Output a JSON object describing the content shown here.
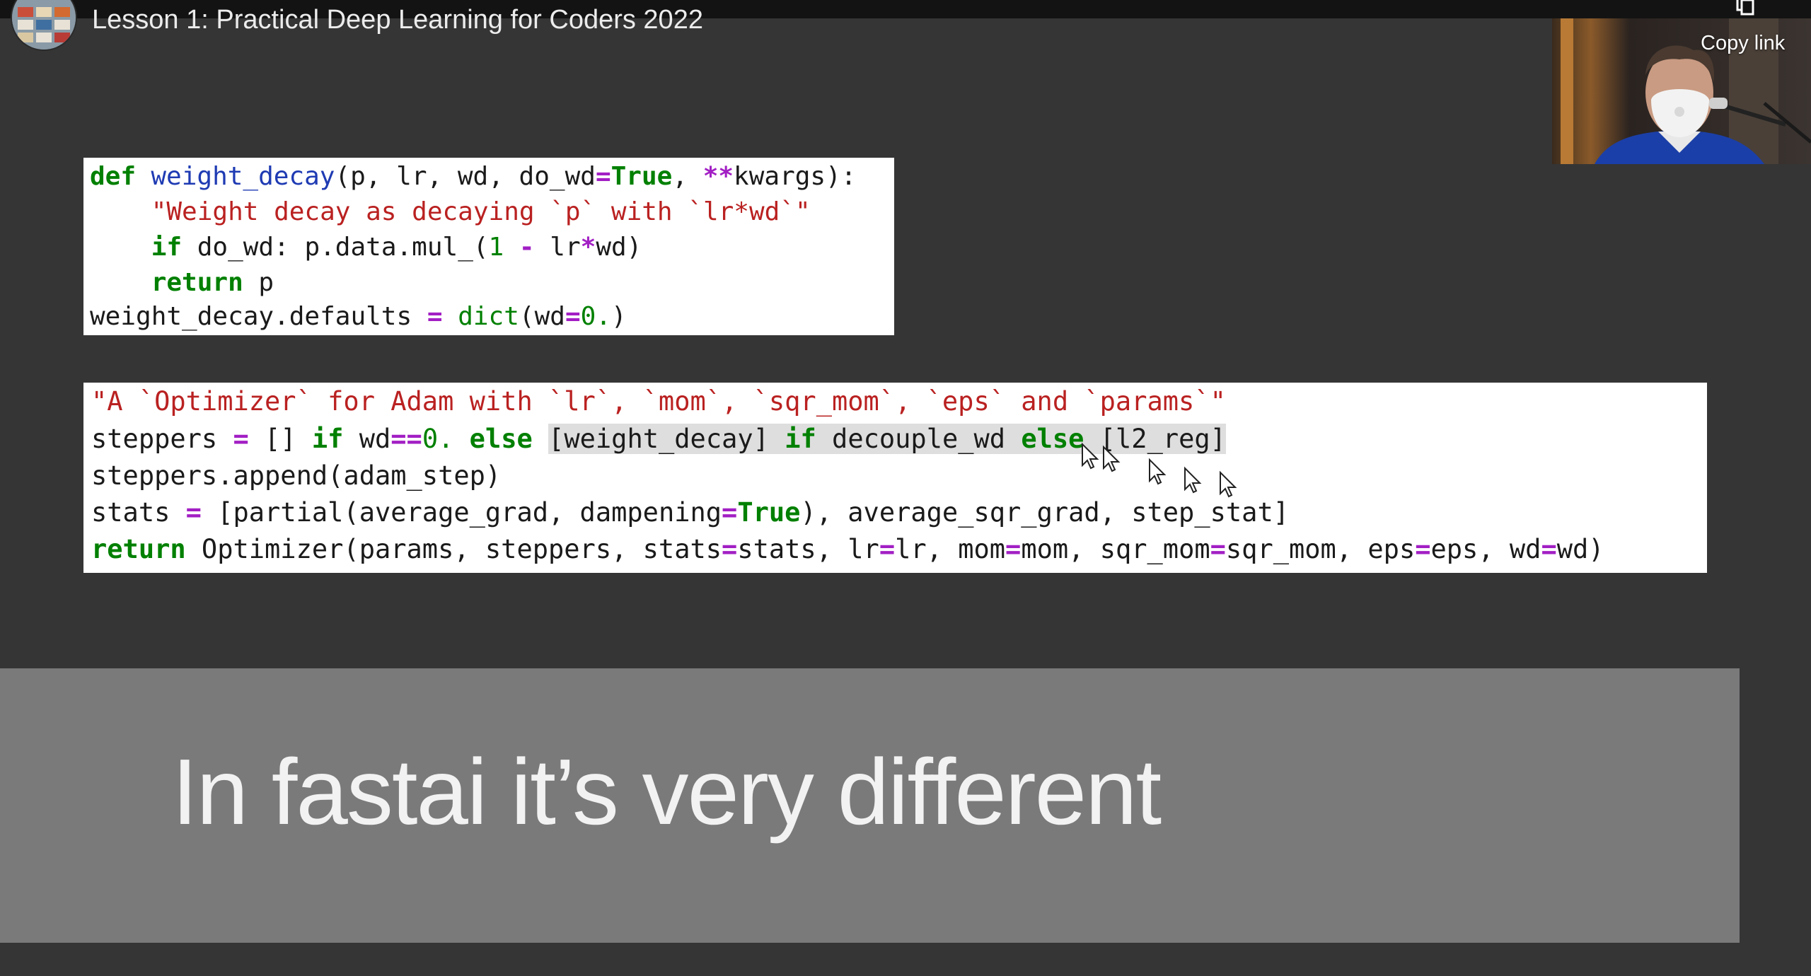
{
  "player": {
    "title": "Lesson 1: Practical Deep Learning for Coders 2022",
    "copy_link_label": "Copy link"
  },
  "slide": {
    "code_block_1": [
      [
        "def ",
        " weight_decay",
        "(p, lr, wd, do_wd",
        "=",
        "True",
        ", ",
        "**",
        "kwargs):"
      ],
      [
        "    \"Weight decay as decaying `p` with `lr*wd`\""
      ],
      [
        "    ",
        "if",
        " do_wd: p.data.mul_(",
        "1",
        " ",
        "-",
        " lr",
        "*",
        "wd)"
      ],
      [
        "    ",
        "return",
        " p"
      ],
      [
        "weight_decay.defaults ",
        "=",
        " ",
        "dict",
        "(wd",
        "=",
        "0.",
        ")"
      ]
    ],
    "code_block_2": [
      [
        "\"A `Optimizer` for Adam with `lr`, `mom`, `sqr_mom`, `eps` and `params`\""
      ],
      [
        "steppers ",
        "=",
        " [] ",
        "if",
        " wd",
        "==",
        "0.",
        " ",
        "else",
        " ",
        "[weight_decay] ",
        "if",
        " decouple_wd ",
        "else",
        " [l2_reg]"
      ],
      [
        "steppers.append(adam_step)"
      ],
      [
        "stats ",
        "=",
        " [partial(average_grad, dampening",
        "=",
        "True",
        "), average_sqr_grad, step_stat]"
      ],
      [
        "return",
        " Optimizer(params, steppers, stats",
        "=",
        "stats, lr",
        "=",
        "lr, mom",
        "=",
        "mom, sqr_mom",
        "=",
        "sqr_mom, eps",
        "=",
        "eps, wd",
        "=",
        "wd)"
      ]
    ],
    "caption": "In fastai it’s very different"
  },
  "icons": {
    "channel_avatar": "channel-avatar-icon",
    "copy_link": "copy-link-icon",
    "mouse_cursor": "mouse-pointer-icon"
  },
  "colors": {
    "background": "#353535",
    "code_keyword": "#008000",
    "code_function": "#1f3bb3",
    "code_operator": "#a21fc4",
    "code_string": "#ba2121",
    "caption_band": "#7a7a7b"
  }
}
